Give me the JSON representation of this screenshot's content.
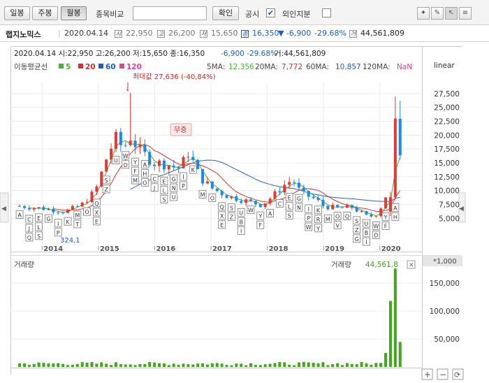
{
  "toolbar": {
    "tab_daily": "일봉",
    "tab_weekly": "주봉",
    "tab_monthly": "월봉",
    "compare_label": "종목비교",
    "confirm_label": "확인",
    "disclosure_label": "공시",
    "disclosure_checked": "✔",
    "foreign_label": "외인지분"
  },
  "info": {
    "name": "랩지노믹스",
    "date": "2020.04.14",
    "badge_open": "시",
    "open": "22,950",
    "badge_high": "고",
    "high": "26,200",
    "badge_low": "저",
    "low": "15,650",
    "badge_close": "종",
    "close": "16,350",
    "change": "▼ -6,900",
    "change_pct": "-29.68%",
    "badge_volume": "거",
    "volume": "44,561,809"
  },
  "chart": {
    "summary": "2020.04.14 시:22,950 고:26,200 저:15,650 종:16,350 ",
    "summary_change": "-6,900 -29.68%",
    "summary_volume": " 거:44,561,809",
    "ma_title": "이동평균선",
    "ma_periods": [
      "5",
      "20",
      "60",
      "120"
    ],
    "ma_colors": [
      "#4caf3a",
      "#d32f2f",
      "#1e5bc6",
      "#e040a0"
    ],
    "ma_values_label": [
      "5MA:",
      "20MA:",
      "60MA:",
      "120MA:"
    ],
    "ma_values": [
      "12,356",
      "7,772",
      "10,857",
      "NaN"
    ],
    "scale": "linear",
    "max_annotation": "최대값 27,636 (-40,84%)",
    "event_tag": "무증",
    "min_annotation": "324,1",
    "volume_label": "거래량",
    "volume_value": "44,561,8",
    "volume_unit": "*1,000",
    "colors": {
      "up": "#e53935",
      "down": "#1e88e5",
      "volume": "#43a61f"
    }
  },
  "chart_data": [
    {
      "type": "candlestick",
      "x": [
        "2014",
        "2015",
        "2016",
        "2017",
        "2018",
        "2019",
        "2020"
      ],
      "y_ticks": [
        5000,
        7500,
        10000,
        12500,
        15000,
        17500,
        20000,
        22500,
        25000,
        27500
      ],
      "ylim": [
        0,
        29500
      ],
      "scale": "linear",
      "last": {
        "date": "2020.04.14",
        "open": 22950,
        "high": 26200,
        "low": 15650,
        "close": 16350
      }
    },
    {
      "type": "bar",
      "label": "거래량",
      "unit": "*1,000",
      "y_ticks": [
        50000,
        100000,
        150000
      ],
      "ylim": [
        0,
        175000
      ]
    }
  ]
}
